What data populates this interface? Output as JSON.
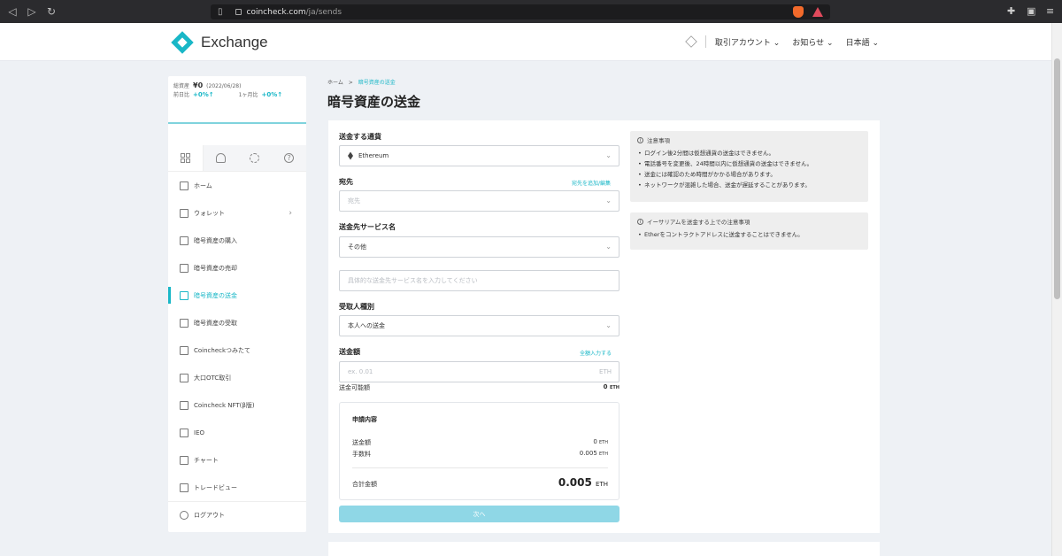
{
  "browser": {
    "url_host": "coincheck.com",
    "url_path": "/ja/sends"
  },
  "header": {
    "logo_text": "Exchange",
    "menu": [
      "取引アカウント",
      "お知らせ",
      "日本語"
    ]
  },
  "sidebar": {
    "balance_label": "総資産",
    "balance_value": "¥0",
    "balance_date": "(2022/06/28)",
    "day_label": "前日比",
    "day_change": "+0%↑",
    "month_label": "1ヶ月比",
    "month_change": "+0%↑",
    "tabs": [
      "grid-icon",
      "person-icon",
      "gear-icon",
      "help-icon"
    ],
    "items": [
      {
        "label": "ホーム",
        "icon": "home-icon"
      },
      {
        "label": "ウォレット",
        "icon": "wallet-icon"
      },
      {
        "label": "暗号資産の購入",
        "icon": "cube-icon"
      },
      {
        "label": "暗号資産の売却",
        "icon": "cube-icon"
      },
      {
        "label": "暗号資産の送金",
        "icon": "send-icon"
      },
      {
        "label": "暗号資産の受取",
        "icon": "qr-icon"
      },
      {
        "label": "Coincheckつみたて",
        "icon": "coins-icon"
      },
      {
        "label": "大口OTC取引",
        "icon": "truck-icon"
      },
      {
        "label": "Coincheck NFT(β版)",
        "icon": "nft-icon"
      },
      {
        "label": "IEO",
        "icon": "ieo-icon"
      },
      {
        "label": "チャート",
        "icon": "chart-icon"
      },
      {
        "label": "トレードビュー",
        "icon": "tradeview-icon"
      }
    ],
    "logout": "ログアウト"
  },
  "main": {
    "breadcrumb_home": "ホーム",
    "breadcrumb_sep": ">",
    "breadcrumb_current": "暗号資産の送金",
    "title": "暗号資産の送金",
    "currency_label": "送金する通貨",
    "currency_value": "Ethereum",
    "dest_label": "宛先",
    "dest_link": "宛先を追加/編集",
    "dest_placeholder": "宛先",
    "service_label": "送金先サービス名",
    "service_value": "その他",
    "service_detail_placeholder": "具体的な送金先サービス名を入力してください",
    "recipient_label": "受取人種別",
    "recipient_value": "本人への送金",
    "amount_label": "送金額",
    "amount_link": "全額入力する",
    "amount_placeholder": "ex. 0.01",
    "amount_unit": "ETH",
    "available_label": "送金可能額",
    "available_value": "0",
    "available_unit": "ETH",
    "summary": {
      "title": "申請内容",
      "amount_label": "送金額",
      "amount_value": "0",
      "fee_label": "手数料",
      "fee_value": "0.005",
      "total_label": "合計金額",
      "total_value": "0.005",
      "unit": "ETH"
    },
    "next_button": "次へ"
  },
  "notes": [
    {
      "title": "注意事項",
      "items": [
        "ログイン後2分間は仮想通貨の送金はできません。",
        "電話番号を変更後、24時間以内に仮想通貨の送金はできません。",
        "送金には確認のため時間がかかる場合があります。",
        "ネットワークが混雑した場合、送金が遅延することがあります。"
      ]
    },
    {
      "title": "イーサリアムを送金する上での注意事項",
      "items": [
        "Etherをコントラクトアドレスに送金することはできません。"
      ]
    }
  ],
  "colors": {
    "accent": "#19b7c7",
    "button_disabled": "#8fd7e6"
  }
}
